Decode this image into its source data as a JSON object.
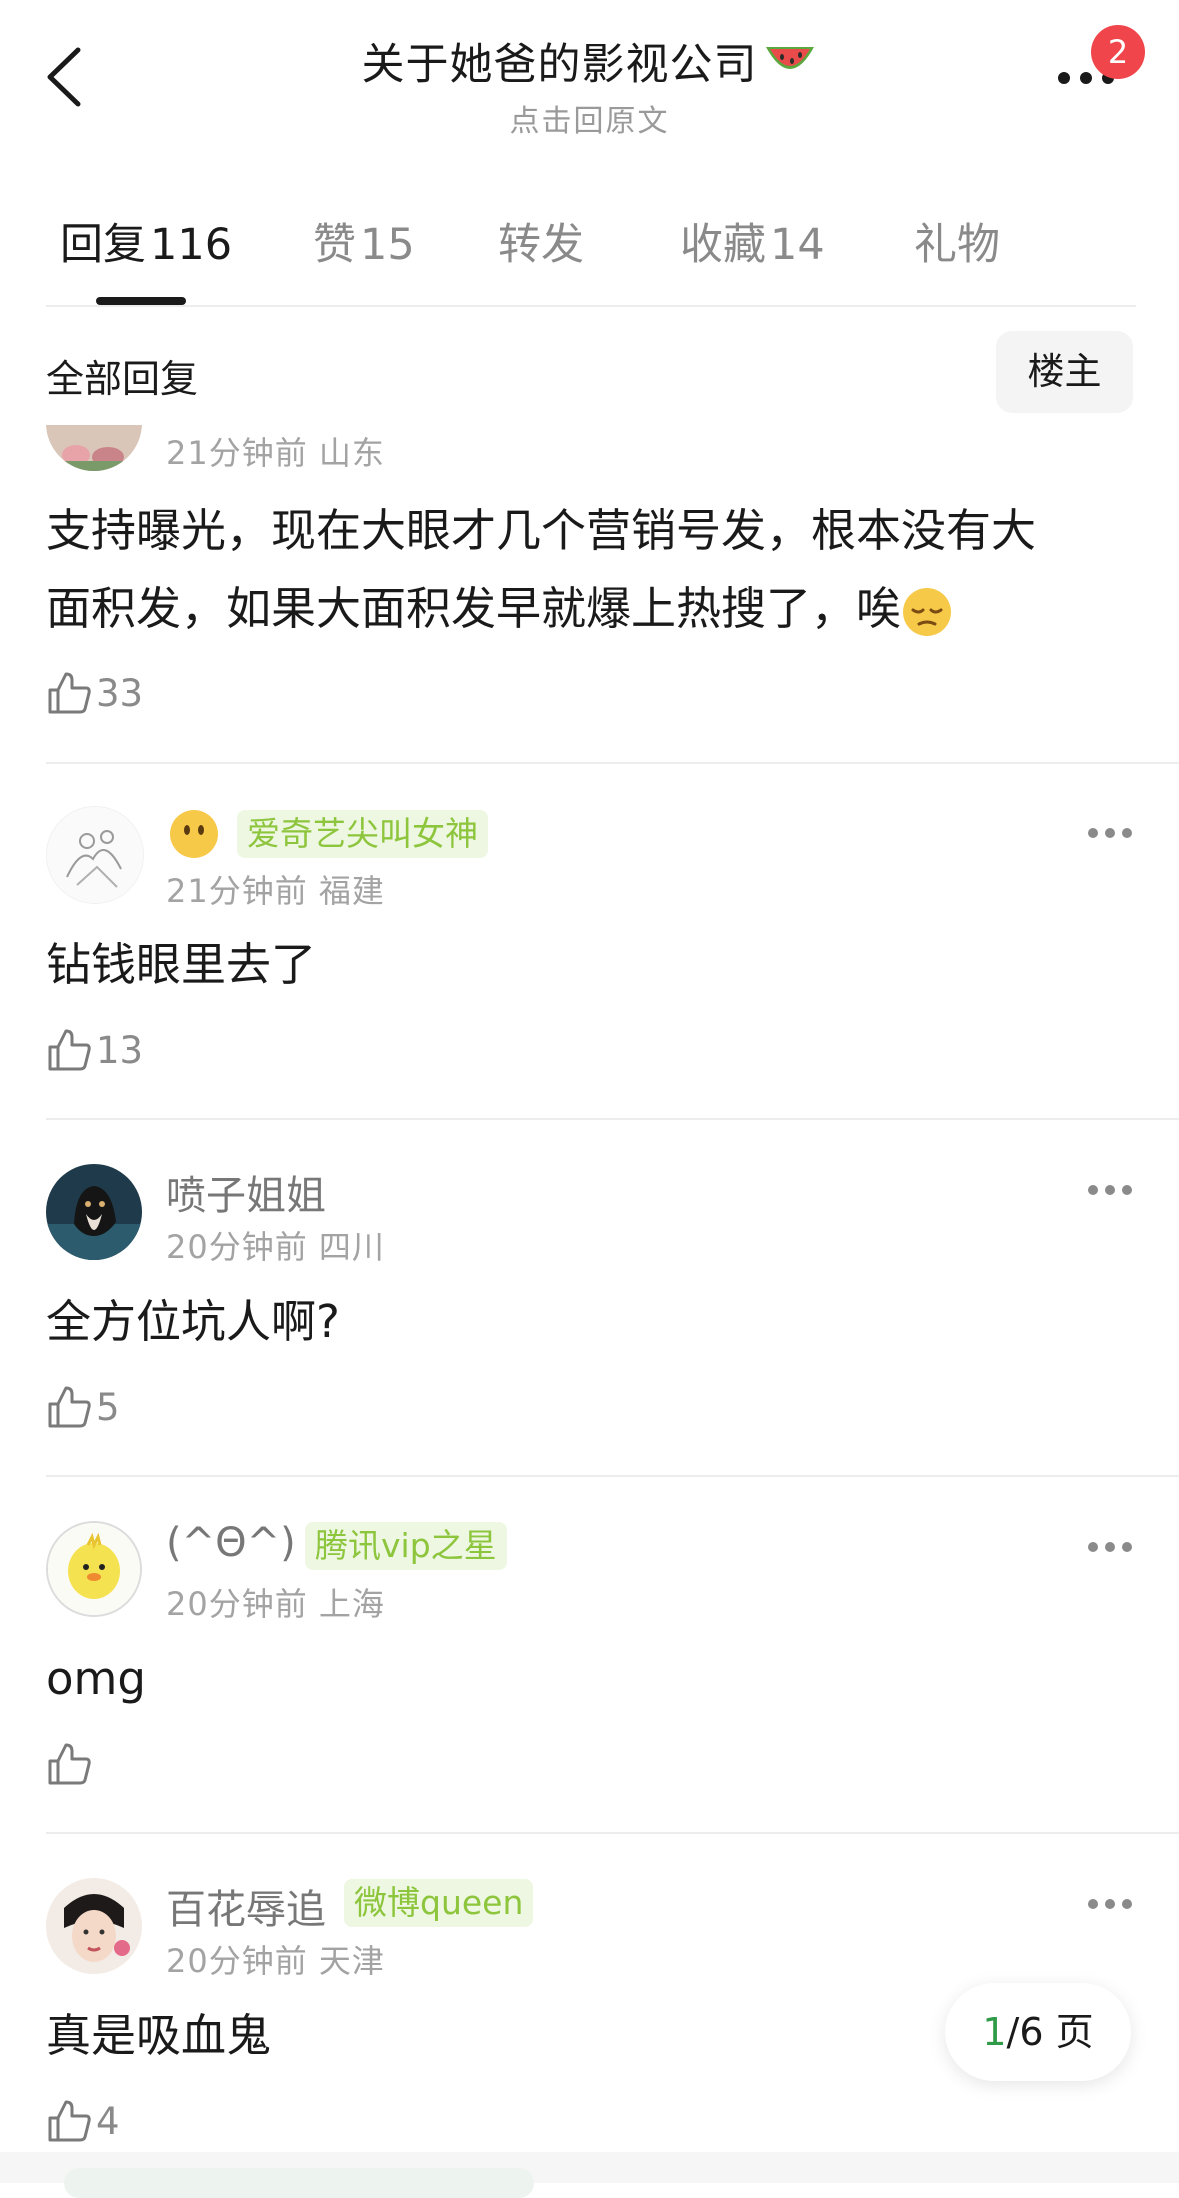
{
  "header": {
    "title": "关于她爸的影视公司",
    "title_emoji": "watermelon-icon",
    "subtitle": "点击回原文",
    "notification_count": "2"
  },
  "tabs": [
    {
      "label": "回复",
      "count": "116",
      "active": true
    },
    {
      "label": "赞",
      "count": "15",
      "active": false
    },
    {
      "label": "转发",
      "count": "",
      "active": false
    },
    {
      "label": "收藏",
      "count": "14",
      "active": false
    },
    {
      "label": "礼物",
      "count": "",
      "active": false
    }
  ],
  "filter": {
    "label": "全部回复",
    "owner_button": "楼主"
  },
  "comments": [
    {
      "user": "",
      "tag": "",
      "time": "21分钟前",
      "location": "山东",
      "text_line1": "支持曝光，现在大眼才几个营销号发，根本没有大",
      "text_line2": "面积发，如果大面积发早就爆上热搜了，唉",
      "text_emoji": "pensive-face-icon",
      "likes": "33"
    },
    {
      "user": "",
      "user_emoji": "face-without-mouth-icon",
      "tag": "爱奇艺尖叫女神",
      "time": "21分钟前",
      "location": "福建",
      "text_line1": "钻钱眼里去了",
      "likes": "13"
    },
    {
      "user": "喷子姐姐",
      "tag": "",
      "time": "20分钟前",
      "location": "四川",
      "text_line1": "全方位坑人啊?",
      "likes": "5"
    },
    {
      "user": "(^Θ^)",
      "tag": "腾讯vip之星",
      "time": "20分钟前",
      "location": "上海",
      "text_line1": "omg",
      "likes": ""
    },
    {
      "user": "百花辱追",
      "tag": "微博queen",
      "time": "20分钟前",
      "location": "天津",
      "text_line1": "真是吸血鬼",
      "likes": "4"
    }
  ],
  "pager": {
    "current": "1",
    "total": "/6",
    "unit": "页"
  },
  "colors": {
    "tag_green": "#8dc53d",
    "tag_bg": "#eef7e2",
    "badge_red": "#f0464b",
    "pager_current": "#2f9a48"
  }
}
